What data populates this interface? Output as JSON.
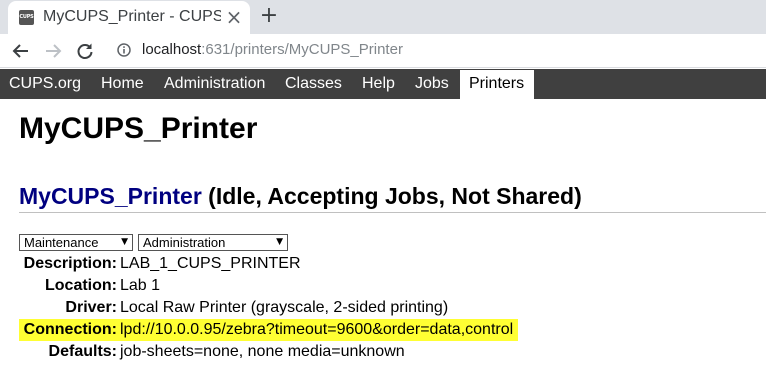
{
  "browser": {
    "tab_title": "MyCUPS_Printer - CUPS",
    "favicon_text": "CUPS",
    "tab_close": "×",
    "new_tab": "+",
    "url_host": "localhost",
    "url_rest": ":631/printers/MyCUPS_Printer"
  },
  "cups_nav": {
    "items": [
      "CUPS.org",
      "Home",
      "Administration",
      "Classes",
      "Help",
      "Jobs",
      "Printers"
    ],
    "active": "Printers",
    "bg_color": "#404040"
  },
  "page": {
    "title": "MyCUPS_Printer",
    "printer_link": "MyCUPS_Printer",
    "printer_status": "(Idle, Accepting Jobs, Not Shared)",
    "link_color": "#000080"
  },
  "selects": {
    "maintenance": "Maintenance",
    "administration": "Administration"
  },
  "details": [
    {
      "label": "Description:",
      "value": "LAB_1_CUPS_PRINTER"
    },
    {
      "label": "Location:",
      "value": "Lab 1"
    },
    {
      "label": "Driver:",
      "value": "Local Raw Printer (grayscale, 2-sided printing)"
    },
    {
      "label": "Connection:",
      "value": "lpd://10.0.0.95/zebra?timeout=9600&order=data,control"
    },
    {
      "label": "Defaults:",
      "value": "job-sheets=none, none media=unknown"
    }
  ],
  "highlight_color": "#ffff33"
}
